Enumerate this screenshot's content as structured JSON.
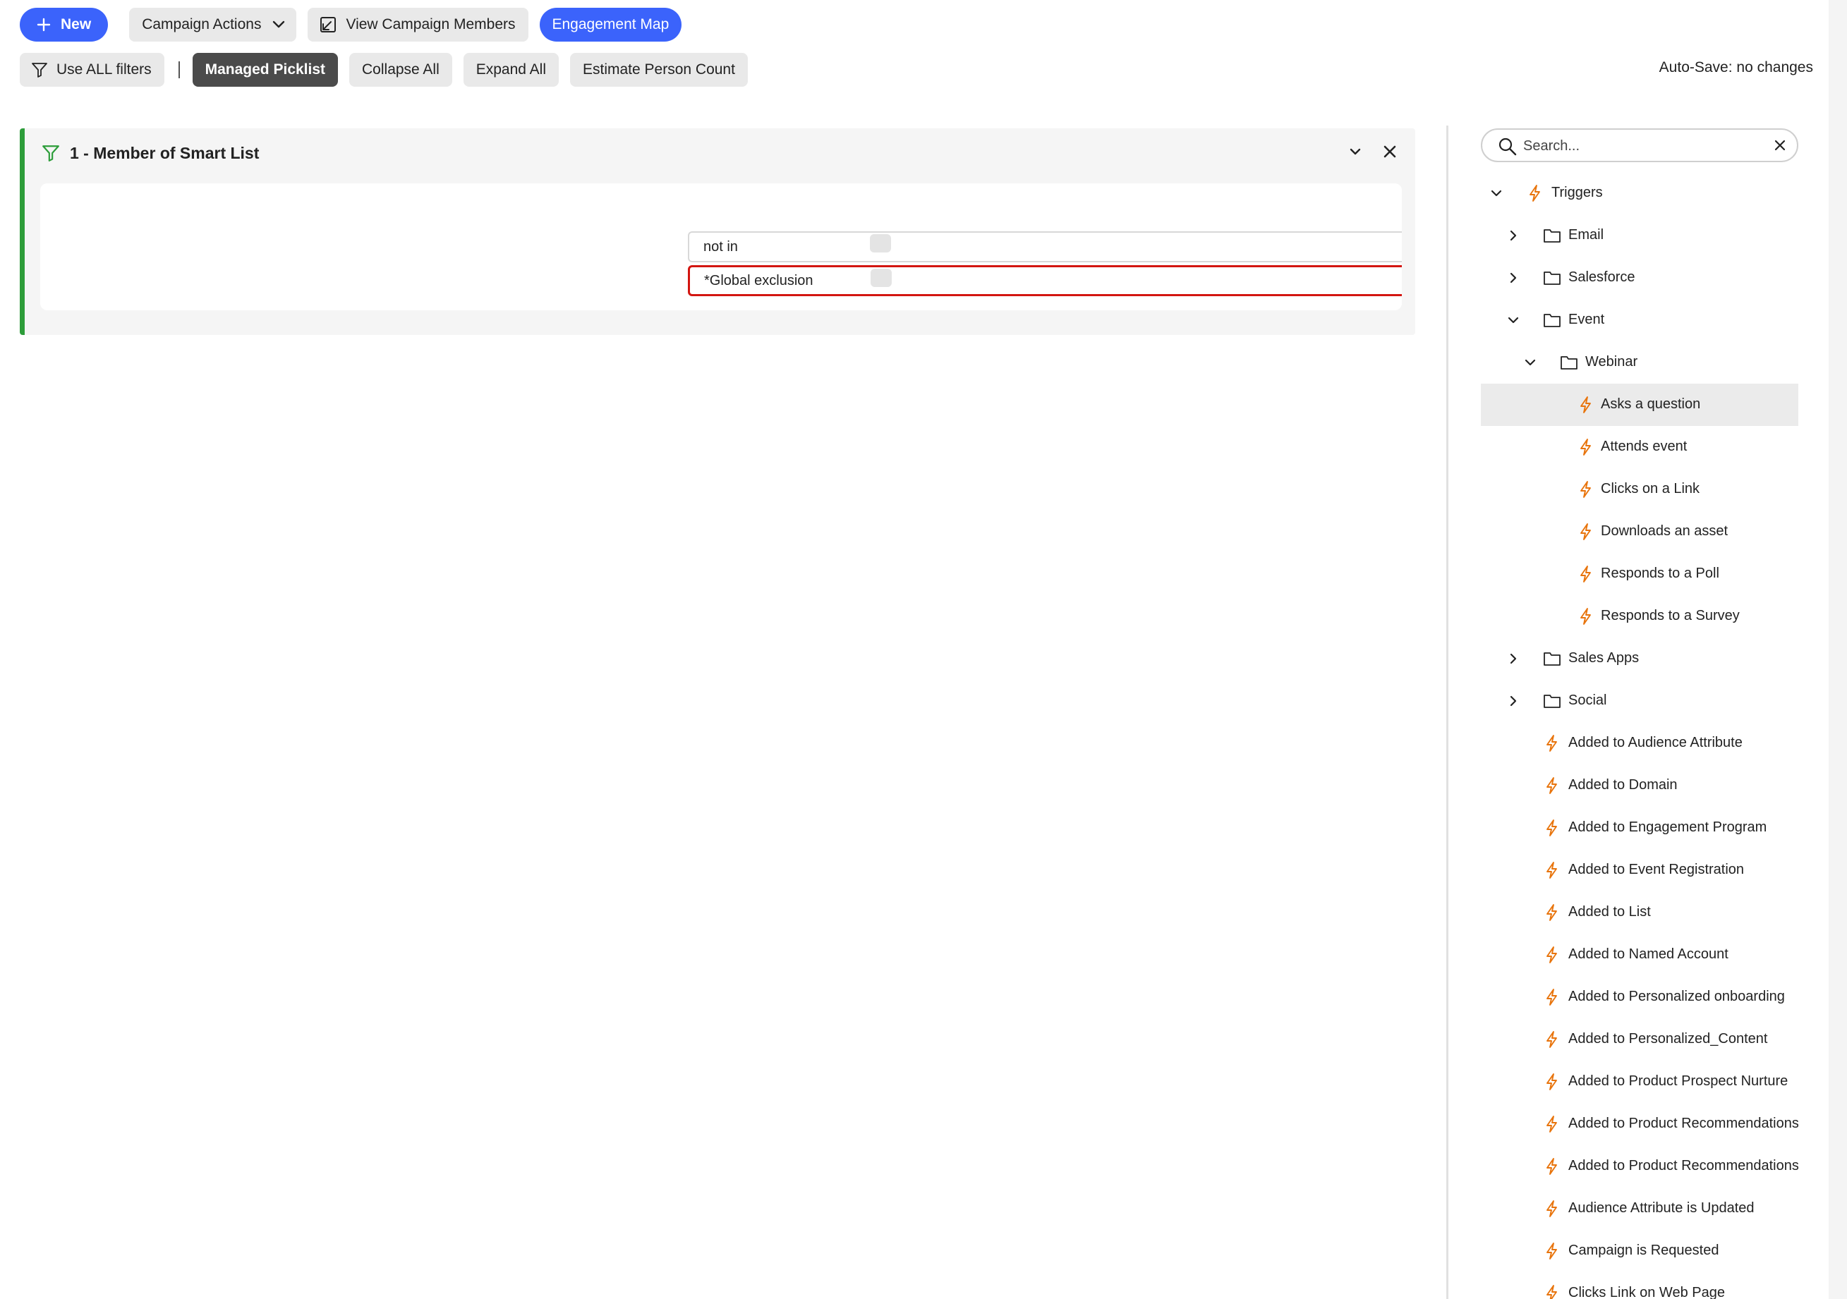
{
  "toolbar": {
    "new_label": "New",
    "campaign_actions_label": "Campaign Actions",
    "view_members_label": "View Campaign Members",
    "engagement_map_label": "Engagement Map",
    "use_all_filters_label": "Use ALL filters",
    "separator": "|",
    "managed_picklist_label": "Managed Picklist",
    "collapse_all_label": "Collapse All",
    "expand_all_label": "Expand All",
    "estimate_count_label": "Estimate Person Count",
    "autosave_status": "Auto-Save: no changes"
  },
  "filter": {
    "title": "1 - Member of Smart List",
    "operator": "not in",
    "value": "*Global exclusion"
  },
  "panel": {
    "search_placeholder": "Search..."
  },
  "tree": [
    {
      "label": "Triggers",
      "kind": "trigger",
      "level": 0,
      "chevron": "down"
    },
    {
      "label": "Email",
      "kind": "folder",
      "level": 1,
      "chevron": "right"
    },
    {
      "label": "Salesforce",
      "kind": "folder",
      "level": 1,
      "chevron": "right"
    },
    {
      "label": "Event",
      "kind": "folder",
      "level": 1,
      "chevron": "down"
    },
    {
      "label": "Webinar",
      "kind": "folder",
      "level": 2,
      "chevron": "down"
    },
    {
      "label": "Asks a question",
      "kind": "trigger",
      "level": 3,
      "selected": true
    },
    {
      "label": "Attends event",
      "kind": "trigger",
      "level": 3
    },
    {
      "label": "Clicks on a Link",
      "kind": "trigger",
      "level": 3
    },
    {
      "label": "Downloads an asset",
      "kind": "trigger",
      "level": 3
    },
    {
      "label": "Responds to a Poll",
      "kind": "trigger",
      "level": 3
    },
    {
      "label": "Responds to a Survey",
      "kind": "trigger",
      "level": 3
    },
    {
      "label": "Sales Apps",
      "kind": "folder",
      "level": 1,
      "chevron": "right"
    },
    {
      "label": "Social",
      "kind": "folder",
      "level": 1,
      "chevron": "right"
    },
    {
      "label": "Added to Audience Attribute",
      "kind": "trigger",
      "level": 1
    },
    {
      "label": "Added to Domain",
      "kind": "trigger",
      "level": 1
    },
    {
      "label": "Added to Engagement Program",
      "kind": "trigger",
      "level": 1
    },
    {
      "label": "Added to Event Registration",
      "kind": "trigger",
      "level": 1
    },
    {
      "label": "Added to List",
      "kind": "trigger",
      "level": 1
    },
    {
      "label": "Added to Named Account",
      "kind": "trigger",
      "level": 1
    },
    {
      "label": "Added to Personalized onboarding",
      "kind": "trigger",
      "level": 1
    },
    {
      "label": "Added to Personalized_Content",
      "kind": "trigger",
      "level": 1
    },
    {
      "label": "Added to Product Prospect Nurture",
      "kind": "trigger",
      "level": 1
    },
    {
      "label": "Added to Product Recommendations S",
      "kind": "trigger",
      "level": 1
    },
    {
      "label": "Added to Product Recommendations S",
      "kind": "trigger",
      "level": 1
    },
    {
      "label": "Audience Attribute is Updated",
      "kind": "trigger",
      "level": 1
    },
    {
      "label": "Campaign is Requested",
      "kind": "trigger",
      "level": 1
    },
    {
      "label": "Clicks Link on Web Page",
      "kind": "trigger",
      "level": 1
    }
  ],
  "colors": {
    "primary_blue": "#3b63fb",
    "dark_button": "#4b4b4b",
    "filter_accent_green": "#2d9d3a",
    "error_red": "#d31510",
    "trigger_icon_orange": "#e8740c"
  },
  "icons": {
    "new": "plus-icon",
    "campaign_actions": "chevron-down-icon",
    "view_members": "open-external-icon",
    "filters": "filter-icon",
    "filter_card": "filter-icon",
    "collapse": "chevron-down-icon",
    "remove": "close-icon",
    "search": "search-icon",
    "clear": "close-icon",
    "trigger": "lightning-bolt-icon",
    "folder": "folder-icon"
  }
}
